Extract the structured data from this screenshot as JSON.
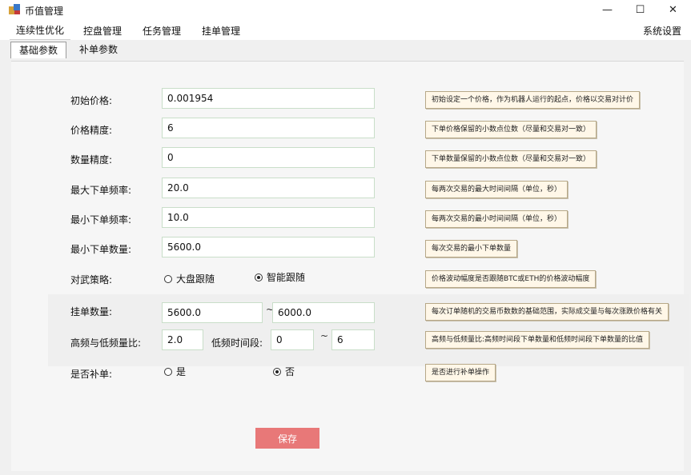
{
  "window": {
    "title": "币值管理",
    "minimize": "—",
    "maximize": "☐",
    "close": "✕"
  },
  "menu": {
    "items": [
      "连续性优化",
      "控盘管理",
      "任务管理",
      "挂单管理"
    ],
    "active": 0,
    "settings": "系统设置"
  },
  "subtabs": {
    "items": [
      "基础参数",
      "补单参数"
    ],
    "active": 0
  },
  "form": {
    "initial_price": {
      "label": "初始价格:",
      "value": "0.001954",
      "hint": "初始设定一个价格，作为机器人运行的起点，价格以交易对计价"
    },
    "price_precision": {
      "label": "价格精度:",
      "value": "6",
      "hint": "下单价格保留的小数点位数（尽量和交易对一致）"
    },
    "qty_precision": {
      "label": "数量精度:",
      "value": "0",
      "hint": "下单数量保留的小数点位数（尽量和交易对一致）"
    },
    "max_freq": {
      "label": "最大下单频率:",
      "value": "20.0",
      "hint": "每两次交易的最大时间间隔（单位，秒）"
    },
    "min_freq": {
      "label": "最小下单频率:",
      "value": "10.0",
      "hint": "每两次交易的最小时间间隔（单位，秒）"
    },
    "min_qty": {
      "label": "最小下单数量:",
      "value": "5600.0",
      "hint": "每次交易的最小下单数量"
    },
    "strategy": {
      "label": "对武策略:",
      "option1": "大盘跟随",
      "option2": "智能跟随",
      "selected": 2,
      "hint": "价格波动幅度是否跟随BTC或ETH的价格波动幅度"
    },
    "order_qty": {
      "label": "挂单数量:",
      "from": "5600.0",
      "to": "6000.0",
      "sep": "~",
      "hint": "每次订单随机的交易币数数的基础范围，实际成交量与每次涨跌价格有关"
    },
    "hf_ratio": {
      "label": "高频与低频量比:",
      "value": "2.0",
      "period_label": "低频时间段:",
      "from": "0",
      "to": "6",
      "sep": "~",
      "hint": "高频与低频量比:高频时间段下单数量和低频时间段下单数量的比值"
    },
    "refill": {
      "label": "是否补单:",
      "yes": "是",
      "no": "否",
      "selected": "no",
      "hint": "是否进行补单操作"
    }
  },
  "save_label": "保存",
  "colors": {
    "save_button": "#e87878",
    "field_border": "#c9dec9",
    "hint_bg": "#fff7e8"
  }
}
